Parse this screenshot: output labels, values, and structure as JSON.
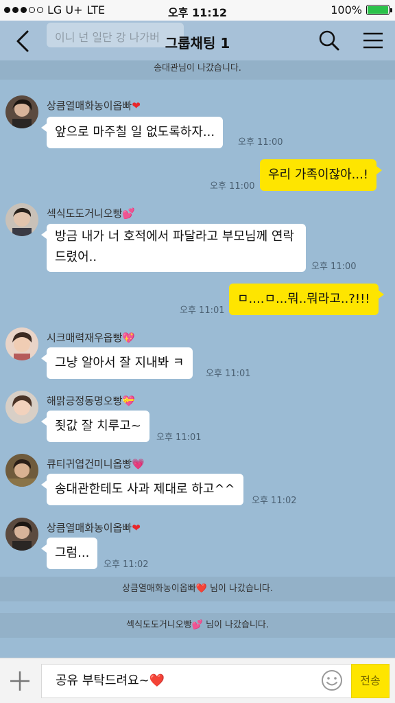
{
  "status": {
    "carrier": "LG U+",
    "network": "LTE",
    "time": "오후 11:12",
    "battery": "100%",
    "battery_level": 1.0
  },
  "header": {
    "ghost_text": "이니 넌 일단 강 나가버",
    "title": "그룹채팅 1"
  },
  "notices": [
    "송대관님이 나갔습니다.",
    "상큼열매화농이옵빠❤️ 님이 나갔습니다.",
    "섹식도도거니오빵💕 님이 나갔습니다."
  ],
  "messages": [
    {
      "sender": "상큼열매화농이옵빠",
      "text": "앞으로 마주칠 일 없도록하자...",
      "time": "오후 11:00"
    },
    {
      "mine": true,
      "text": "우리 가족이잖아...!",
      "time": "오후 11:00"
    },
    {
      "sender": "섹식도도거니오빵",
      "text": "방금 내가 너 호적에서 파달라고 부모님께 연락 드렸어..",
      "time": "오후 11:00"
    },
    {
      "mine": true,
      "text": "ㅁ....ㅁ...뭐..뭐라고..?!!!",
      "time": "오후 11:01"
    },
    {
      "sender": "시크매력재우옵빵",
      "text": "그냥 알아서 잘 지내봐 ㅋ",
      "time": "오후 11:01"
    },
    {
      "sender": "해맑긍정동명오빵",
      "text": "죗값 잘 치루고~",
      "time": "오후 11:01"
    },
    {
      "sender": "큐티귀엽건미니옵빵",
      "text": "송대관한테도 사과 제대로 하고^^",
      "time": "오후 11:02"
    },
    {
      "sender": "상큼열매화농이옵빠",
      "text": "그럼...",
      "time": "오후 11:02"
    }
  ],
  "input": {
    "text": "공유 부탁드려요~❤️",
    "send_label": "전송"
  },
  "icons": [
    "back-icon",
    "search-icon",
    "menu-icon",
    "plus-icon",
    "emoji-icon"
  ],
  "colors": {
    "background": "#9bbbd4",
    "my_bubble": "#fee500",
    "other_bubble": "#ffffff",
    "heart": "#e8262a"
  }
}
